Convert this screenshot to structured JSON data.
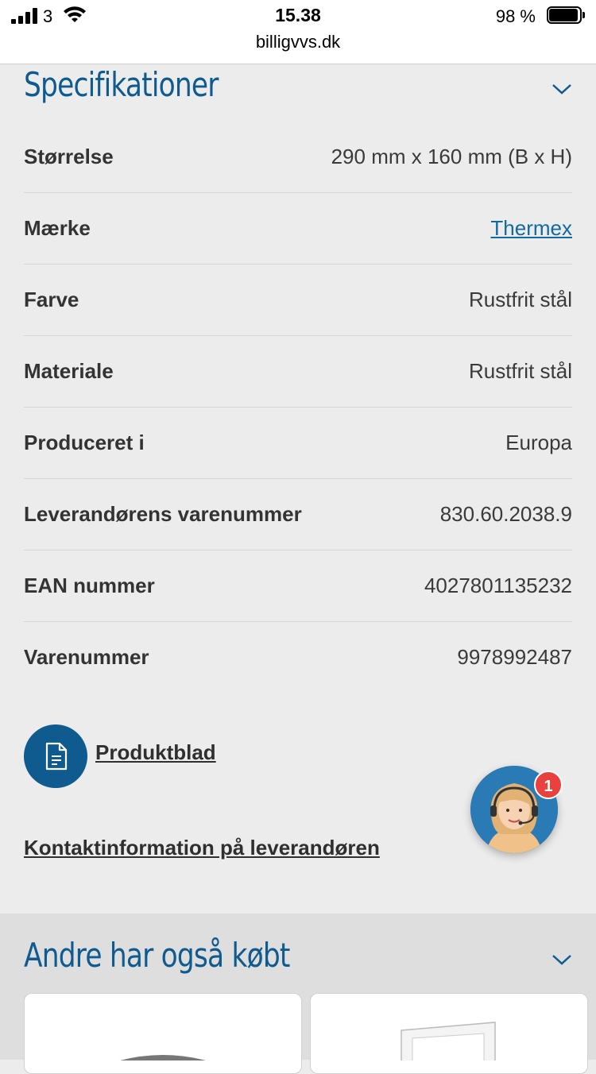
{
  "status_bar": {
    "carrier": "3",
    "time": "15.38",
    "url": "billigvvs.dk",
    "battery": "98 %",
    "battery_level": 0.98,
    "icons": [
      "signal-icon",
      "wifi-icon",
      "battery-icon"
    ]
  },
  "specs": {
    "title": "Specifikationer",
    "rows": [
      {
        "label": "Størrelse",
        "value": "290 mm x 160 mm (B x H)"
      },
      {
        "label": "Mærke",
        "value": "Thermex",
        "is_link": true
      },
      {
        "label": "Farve",
        "value": "Rustfrit stål"
      },
      {
        "label": "Materiale",
        "value": "Rustfrit stål"
      },
      {
        "label": "Produceret i",
        "value": "Europa"
      },
      {
        "label": "Leverandørens varenummer",
        "value": "830.60.2038.9"
      },
      {
        "label": "EAN nummer",
        "value": "4027801135232"
      },
      {
        "label": "Varenummer",
        "value": "9978992487"
      }
    ],
    "product_sheet_label": "Produktblad",
    "contact_link_label": "Kontaktinformation på leverandøren"
  },
  "chat": {
    "badge_count": "1",
    "icon": "support-agent-avatar"
  },
  "also_bought": {
    "title": "Andre har også købt"
  },
  "colors": {
    "brand_blue": "#0f5a8f",
    "link_blue": "#136aa0",
    "badge_red": "#e8413e"
  }
}
